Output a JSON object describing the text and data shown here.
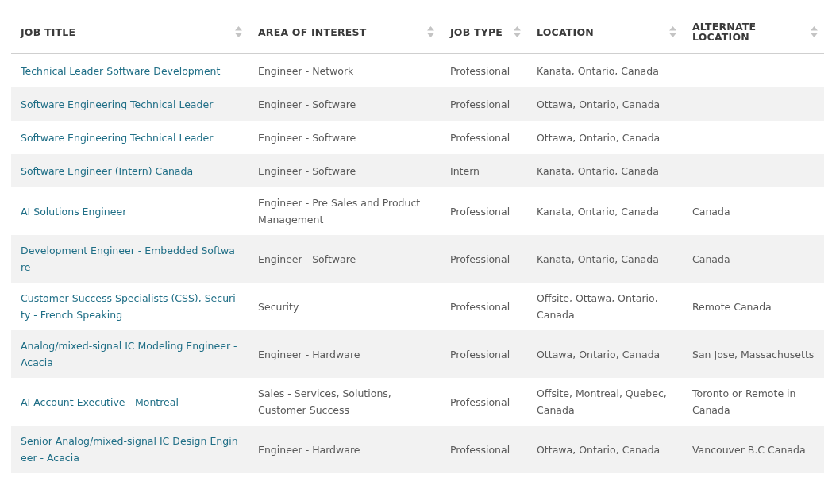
{
  "table": {
    "columns": [
      "JOB TITLE",
      "AREA OF INTEREST",
      "JOB TYPE",
      "LOCATION",
      "ALTERNATE LOCATION"
    ],
    "rows": [
      {
        "job_title": "Technical Leader Software Development",
        "area_of_interest": "Engineer - Network",
        "job_type": "Professional",
        "location": "Kanata, Ontario, Canada",
        "alternate_location": ""
      },
      {
        "job_title": "Software Engineering Technical Leader",
        "area_of_interest": "Engineer - Software",
        "job_type": "Professional",
        "location": "Ottawa, Ontario, Canada",
        "alternate_location": ""
      },
      {
        "job_title": "Software Engineering Technical Leader",
        "area_of_interest": "Engineer - Software",
        "job_type": "Professional",
        "location": "Ottawa, Ontario, Canada",
        "alternate_location": ""
      },
      {
        "job_title": "Software Engineer (Intern) Canada",
        "area_of_interest": "Engineer - Software",
        "job_type": "Intern",
        "location": "Kanata, Ontario, Canada",
        "alternate_location": ""
      },
      {
        "job_title": "AI Solutions Engineer",
        "area_of_interest": "Engineer - Pre Sales and Product Management",
        "job_type": "Professional",
        "location": "Kanata, Ontario, Canada",
        "alternate_location": "Canada"
      },
      {
        "job_title": "Development Engineer - Embedded Software",
        "area_of_interest": "Engineer - Software",
        "job_type": "Professional",
        "location": "Kanata, Ontario, Canada",
        "alternate_location": "Canada"
      },
      {
        "job_title": "Customer Success Specialists (CSS), Security - French Speaking",
        "area_of_interest": "Security",
        "job_type": "Professional",
        "location": "Offsite, Ottawa, Ontario, Canada",
        "alternate_location": "Remote Canada"
      },
      {
        "job_title": "Analog/mixed-signal IC Modeling Engineer - Acacia",
        "area_of_interest": "Engineer - Hardware",
        "job_type": "Professional",
        "location": "Ottawa, Ontario, Canada",
        "alternate_location": "San Jose, Massachusetts"
      },
      {
        "job_title": "AI Account Executive - Montreal",
        "area_of_interest": "Sales - Services, Solutions, Customer Success",
        "job_type": "Professional",
        "location": "Offsite, Montreal, Quebec, Canada",
        "alternate_location": "Toronto or Remote in Canada"
      },
      {
        "job_title": "Senior Analog/mixed-signal IC Design Engineer - Acacia",
        "area_of_interest": "Engineer - Hardware",
        "job_type": "Professional",
        "location": "Ottawa, Ontario, Canada",
        "alternate_location": "Vancouver B.C Canada"
      }
    ]
  }
}
